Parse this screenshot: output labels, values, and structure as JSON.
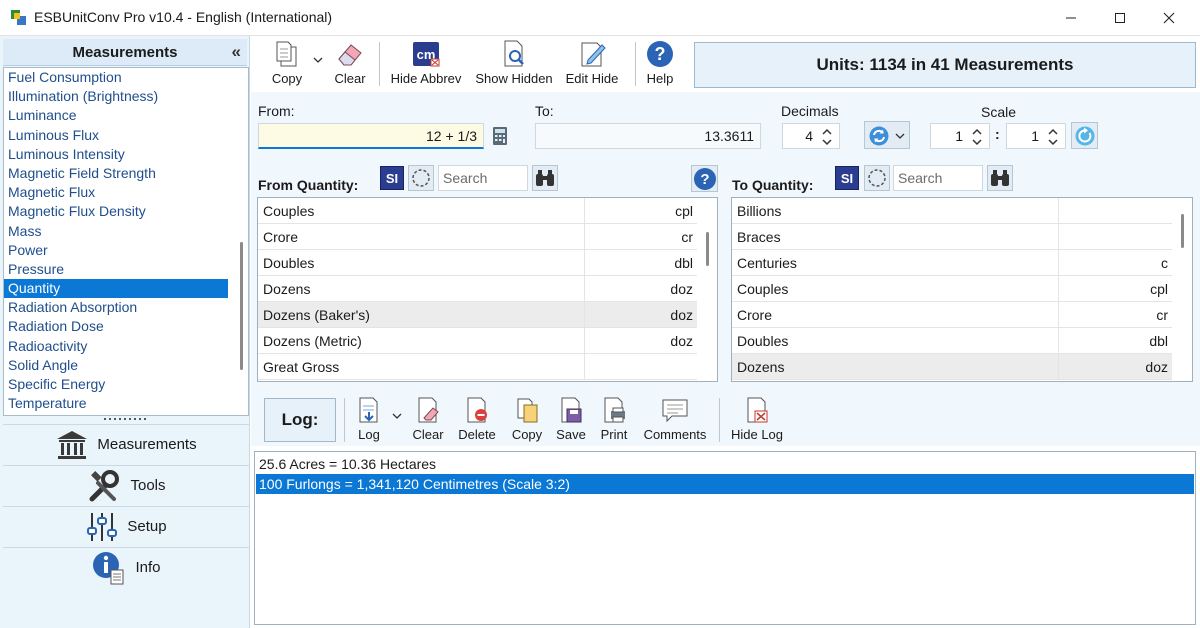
{
  "window": {
    "title": "ESBUnitConv Pro v10.4 - English (International)",
    "minimize": "minimize-icon",
    "maximize": "maximize-icon",
    "close": "close-icon"
  },
  "left_panel": {
    "header": "Measurements",
    "collapse_glyph": "«",
    "items": [
      "Fuel Consumption",
      "Illumination (Brightness)",
      "Luminance",
      "Luminous Flux",
      "Luminous Intensity",
      "Magnetic Field Strength",
      "Magnetic Flux",
      "Magnetic Flux Density",
      "Mass",
      "Power",
      "Pressure",
      "Quantity",
      "Radiation Absorption",
      "Radiation Dose",
      "Radioactivity",
      "Solid Angle",
      "Specific Energy",
      "Temperature"
    ],
    "selected_item": "Quantity",
    "nav": {
      "measurements": "Measurements",
      "tools": "Tools",
      "setup": "Setup",
      "info": "Info"
    }
  },
  "toolbar": {
    "copy": "Copy",
    "clear": "Clear",
    "hide_abbrev": "Hide Abbrev",
    "show_hidden": "Show Hidden",
    "edit_hide": "Edit Hide",
    "help": "Help",
    "cm_glyph": "cm"
  },
  "units_summary": "Units: 1134 in 41 Measurements",
  "converter": {
    "from_label": "From:",
    "from_value": "12 + 1/3",
    "to_label": "To:",
    "to_value": "13.3611",
    "decimals_label": "Decimals",
    "decimals_value": "4",
    "scale_label": "Scale",
    "scale_left": "1",
    "scale_sep": ":",
    "scale_right": "1"
  },
  "from_quantity": {
    "label": "From Quantity:",
    "si": "SI",
    "search_placeholder": "Search",
    "help_glyph": "?",
    "rows": [
      {
        "name": "Couples",
        "abbr": "cpl"
      },
      {
        "name": "Crore",
        "abbr": "cr"
      },
      {
        "name": "Doubles",
        "abbr": "dbl"
      },
      {
        "name": "Dozens",
        "abbr": "doz"
      },
      {
        "name": "Dozens (Baker's)",
        "abbr": "doz"
      },
      {
        "name": "Dozens (Metric)",
        "abbr": "doz"
      },
      {
        "name": "Great Gross",
        "abbr": ""
      }
    ],
    "highlighted": "Dozens (Baker's)"
  },
  "to_quantity": {
    "label": "To Quantity:",
    "si": "SI",
    "search_placeholder": "Search",
    "rows": [
      {
        "name": "Billions",
        "abbr": ""
      },
      {
        "name": "Braces",
        "abbr": ""
      },
      {
        "name": "Centuries",
        "abbr": "c"
      },
      {
        "name": "Couples",
        "abbr": "cpl"
      },
      {
        "name": "Crore",
        "abbr": "cr"
      },
      {
        "name": "Doubles",
        "abbr": "dbl"
      },
      {
        "name": "Dozens",
        "abbr": "doz"
      }
    ],
    "highlighted": "Dozens"
  },
  "log": {
    "label": "Log:",
    "buttons": {
      "log": "Log",
      "clear": "Clear",
      "delete": "Delete",
      "copy": "Copy",
      "save": "Save",
      "print": "Print",
      "comments": "Comments",
      "hide_log": "Hide Log"
    },
    "entries": [
      "25.6 Acres = 10.36 Hectares",
      "100 Furlongs = 1,341,120 Centimetres (Scale 3:2)"
    ],
    "selected_entry": 1
  },
  "colors": {
    "accent": "#0a78d4",
    "panel_bg": "#eaf4fb",
    "link_text": "#1f4e8c",
    "si_badge": "#2b3d8f"
  }
}
